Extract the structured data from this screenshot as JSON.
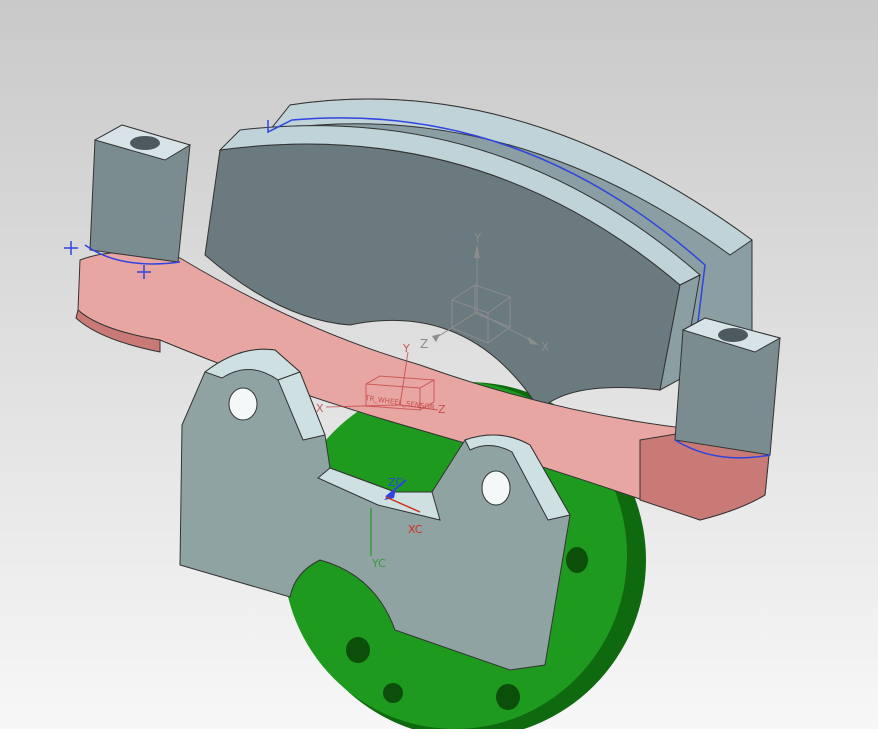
{
  "viewport": {
    "background": {
      "top": "#c9c9c9",
      "bottom": "#f7f7f7"
    }
  },
  "colors": {
    "pad_face": "#6b7a7f",
    "pad_top": "#bfd3d8",
    "pad_side": "#8a9ea3",
    "caliper_face": "#e8a6a2",
    "caliper_side": "#c97a77",
    "bracket_face": "#8fa3a2",
    "bracket_top": "#cfe0e2",
    "disc": "#1e9a1e",
    "disc_dark": "#0f6a0f",
    "sketch_blue": "#2f44e0",
    "csys_gray": "#8c8c8c",
    "datum_red": "#c03a3a",
    "wcs_x": "#d03020",
    "wcs_y": "#3a9a3a",
    "wcs_z": "#2f44e0"
  },
  "model": {
    "datum_csys": {
      "x_label": "X",
      "y_label": "Y",
      "z_label": "Z"
    },
    "part_csys": {
      "x_label": "X",
      "y_label": "Y",
      "z_label": "Z",
      "part_label": "TR_WHEEL_SENSOR"
    },
    "wcs": {
      "x_label": "XC",
      "y_label": "YC",
      "z_label": "ZC"
    }
  }
}
